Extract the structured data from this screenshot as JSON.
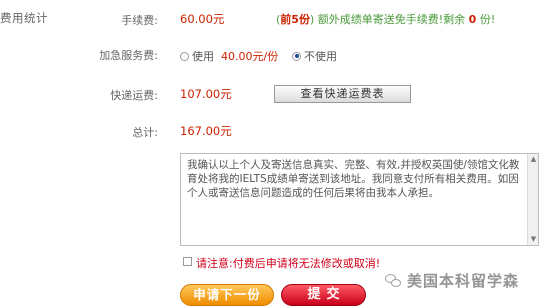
{
  "section": {
    "title": "费用统计"
  },
  "fee_row": {
    "label": "手续费:",
    "amount": "60.00元",
    "note_open": "(",
    "note_rank": "前5份",
    "note_close": ")",
    "note_text": "额外成绩单寄送免手续费!剩余",
    "note_count": "0",
    "note_suffix": "份!"
  },
  "urgent_row": {
    "label": "加急服务费:",
    "option_use": "使用",
    "option_price": "40.00元/份",
    "option_nouse": "不使用",
    "selected": "不使用"
  },
  "courier_row": {
    "label": "快递运费:",
    "amount": "107.00元",
    "view_fee_button": "查看快递运费表"
  },
  "total_row": {
    "label": "总计:",
    "amount": "167.00元"
  },
  "consent": {
    "text": "我确认以上个人及寄送信息真实、完整、有效,并授权英国使/领馆文化教育处将我的IELTS成绩单寄送到该地址。我同意支付所有相关费用。如因个人或寄送信息问题造成的任何后果将由我本人承担。"
  },
  "agreement": {
    "checked": false,
    "prefix": "请注意:",
    "text": "付费后申请将无法修改或取消!"
  },
  "buttons": {
    "next_application": "申请下一份",
    "submit": "提交"
  },
  "watermark": {
    "text": "美国本科留学森"
  },
  "colors": {
    "accent_red": "#cc2200",
    "note_green": "#4a9a3a",
    "next_orange": "#f08c00",
    "submit_red": "#c8001a"
  }
}
